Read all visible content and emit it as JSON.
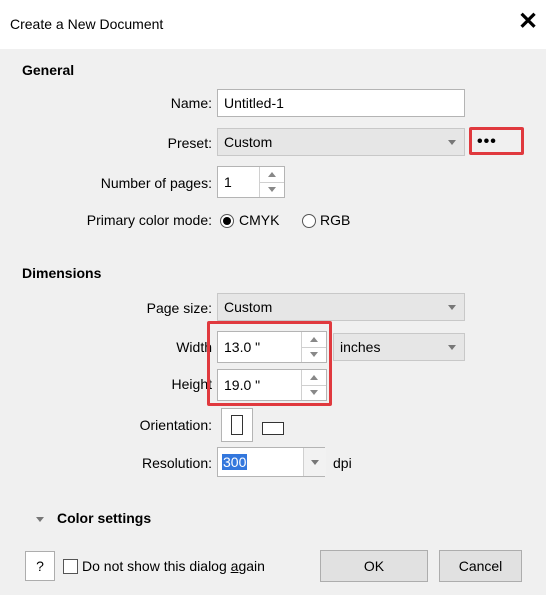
{
  "dialog": {
    "title": "Create a New Document",
    "close_glyph": "✕"
  },
  "general": {
    "heading": "General",
    "name_label": "Name:",
    "name_value": "Untitled-1",
    "preset_label": "Preset:",
    "preset_value": "Custom",
    "more_glyph": "•••",
    "pages_label": "Number of pages:",
    "pages_value": "1",
    "color_mode_label": "Primary color mode:",
    "color_modes": [
      {
        "label": "CMYK",
        "selected": true
      },
      {
        "label": "RGB",
        "selected": false
      }
    ]
  },
  "dimensions": {
    "heading": "Dimensions",
    "page_size_label": "Page size:",
    "page_size_value": "Custom",
    "width_label": "Width",
    "width_value": "13.0 \"",
    "units_value": "inches",
    "height_label": "Height",
    "height_value": "19.0 \"",
    "orientation_label": "Orientation:",
    "resolution_label": "Resolution:",
    "resolution_value": "300",
    "resolution_unit": "dpi"
  },
  "color_settings": {
    "label": "Color settings"
  },
  "footer": {
    "help_label": "?",
    "dont_show_prefix": "Do not show this dialog ",
    "dont_show_underlined": "a",
    "dont_show_suffix": "gain",
    "ok_label": "OK",
    "cancel_label": "Cancel"
  },
  "colors": {
    "highlight": "#e0393e",
    "selection": "#3377dd"
  }
}
